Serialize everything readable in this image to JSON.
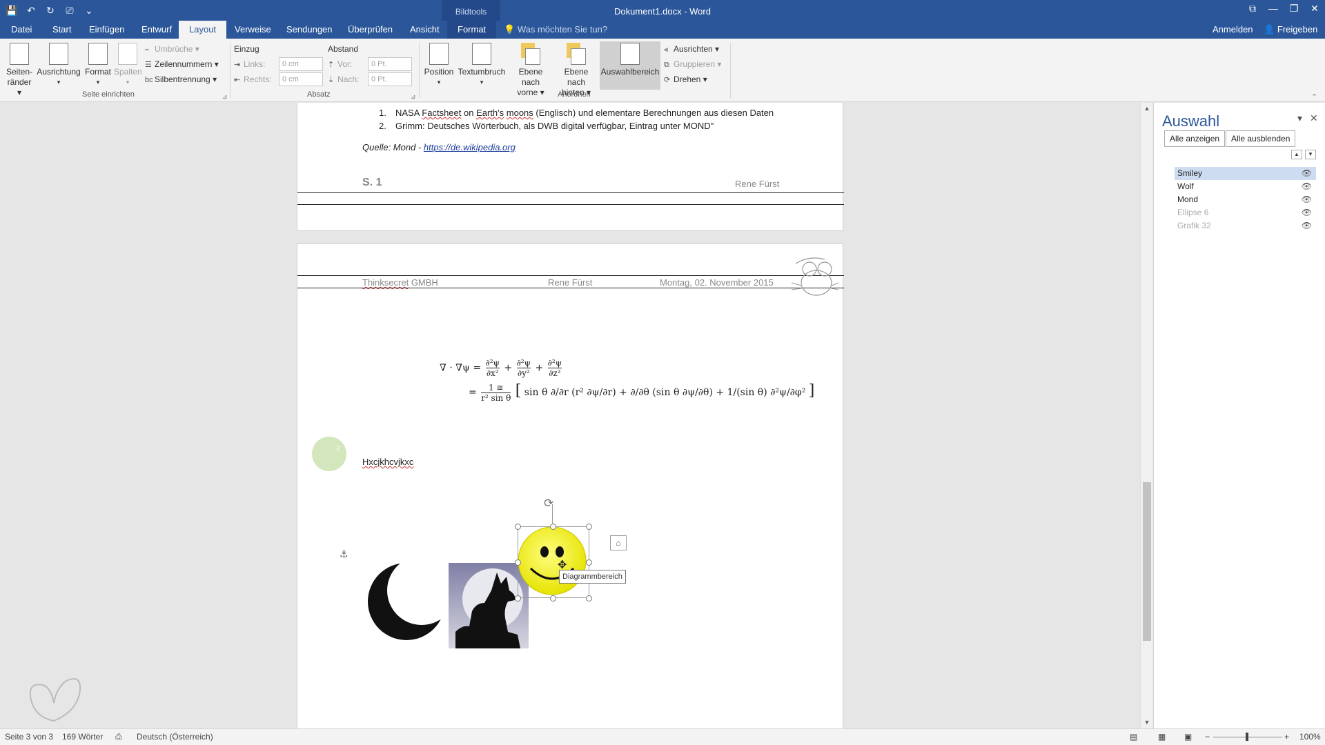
{
  "titlebar": {
    "contextual_group": "Bildtools",
    "document_title": "Dokument1.docx - Word",
    "qat_icons": [
      "save-icon",
      "undo-icon",
      "redo-icon",
      "touch-mode-icon",
      "customize-icon"
    ],
    "qat_glyphs": [
      "💾",
      "↶",
      "↻",
      "⎚",
      "⌄"
    ],
    "window_glyphs": [
      "⧉",
      "—",
      "❐",
      "✕"
    ]
  },
  "tabs": {
    "items": [
      "Datei",
      "Start",
      "Einfügen",
      "Entwurf",
      "Layout",
      "Verweise",
      "Sendungen",
      "Überprüfen",
      "Ansicht",
      "Format"
    ],
    "active": "Layout",
    "tell_me": "Was möchten Sie tun?",
    "tell_me_glyph": "💡",
    "anmelden": "Anmelden",
    "freigeben": "Freigeben",
    "freigeben_glyph": "👤"
  },
  "ribbon": {
    "seitenraender": "Seiten-\nränder ▾",
    "ausrichtung": "Ausrichtung",
    "format": "Format",
    "spalten": "Spalten",
    "umbrueche": "Umbrüche ▾",
    "zeilennummern": "Zeilennummern ▾",
    "silbentrennung": "Silbentrennung ▾",
    "group_seite": "Seite einrichten",
    "einzug": "Einzug",
    "abstand": "Abstand",
    "links": "Links:",
    "rechts": "Rechts:",
    "vor": "Vor:",
    "nach": "Nach:",
    "links_val": "0 cm",
    "rechts_val": "0 cm",
    "vor_val": "0 Pt.",
    "nach_val": "0 Pt.",
    "group_absatz": "Absatz",
    "position": "Position",
    "textumbruch": "Textumbruch",
    "ebene_vorne": "Ebene nach\nvorne ▾",
    "ebene_hinten": "Ebene nach\nhinten ▾",
    "auswahlbereich": "Auswahlbereich",
    "ausrichten": "Ausrichten ▾",
    "gruppieren": "Gruppieren ▾",
    "drehen": "Drehen ▾",
    "group_anordnen": "Anordnen"
  },
  "document": {
    "list_item_1_num": "1.",
    "list_item_1_a": "NASA ",
    "list_item_1_b": "Factsheet",
    "list_item_1_c": " on ",
    "list_item_1_d": "Earth's",
    "list_item_1_e": " ",
    "list_item_1_f": "moons",
    "list_item_1_g": " (Englisch) und elementare Berechnungen aus diesen Daten",
    "list_item_2_num": "2.",
    "list_item_2": "Grimm: Deutsches Wörterbuch, als DWB digital verfügbar, Eintrag unter MOND\"",
    "source_label": "Quelle: Mond - ",
    "source_link": "https://de.wikipedia.org",
    "footer_page": "S. 1",
    "footer_author": "Rene Fürst",
    "header_company": "Thinksecret",
    "header_company_rest": " GMBH",
    "header_author": "Rene Fürst",
    "header_date": "Montag, 02. November 2015",
    "eq_lhs": "∇ · ∇ψ =",
    "eq_line2_prefix": "=",
    "eq_frac_one_num": "1 ≅",
    "eq_frac_one_den": "r² sin θ",
    "ellipse_text": "2",
    "body_word": "Hxcjkhcvjkxc",
    "tooltip": "Diagrammbereich"
  },
  "scrollbar": {
    "up_glyph": "▲",
    "down_glyph": "▼"
  },
  "selection_pane": {
    "title": "Auswahl",
    "show_all": "Alle anzeigen",
    "hide_all": "Alle ausblenden",
    "dropdown_glyph": "▾",
    "close_glyph": "✕",
    "up_glyph": "▲",
    "down_glyph": "▼",
    "eye_glyph": "👁",
    "items": [
      {
        "label": "Smiley",
        "selected": true,
        "dimmed": false
      },
      {
        "label": "Wolf",
        "selected": false,
        "dimmed": false
      },
      {
        "label": "Mond",
        "selected": false,
        "dimmed": false
      },
      {
        "label": "Ellipse 6",
        "selected": false,
        "dimmed": true
      },
      {
        "label": "Grafik 32",
        "selected": false,
        "dimmed": true
      }
    ]
  },
  "statusbar": {
    "page": "Seite 3 von 3",
    "words": "169 Wörter",
    "language": "Deutsch (Österreich)",
    "zoom": "100%",
    "minus": "−",
    "plus": "+"
  },
  "colors": {
    "word_blue": "#2b579a",
    "smiley_yellow": "#f3f20e",
    "ellipse_green": "#d3e6bc",
    "moon_black": "#111111"
  }
}
